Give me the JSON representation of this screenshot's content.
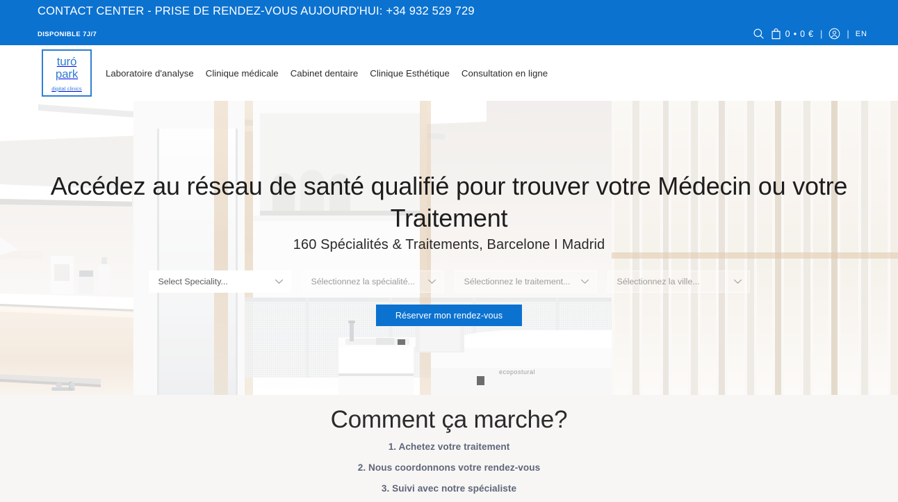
{
  "topbar": {
    "phone_text": "CONTACT CENTER - PRISE DE RENDEZ-VOUS AUJOURD'HUI: +34 932 529 729",
    "availability": "DISPONIBLE 7J/7",
    "search_icon": "search-icon",
    "cart_icon": "shopping-bag-icon",
    "cart_text": "0 • 0 €",
    "account_icon": "account-circle-icon",
    "separator": "|",
    "language": "EN",
    "bg_color": "#0b72d0"
  },
  "header": {
    "logo": {
      "line1": "turó",
      "line2": "park",
      "line3": "digital clinics",
      "color": "#2f7fd1"
    },
    "nav": [
      {
        "label": "Laboratoire d'analyse"
      },
      {
        "label": "Clinique médicale"
      },
      {
        "label": "Cabinet dentaire"
      },
      {
        "label": "Clinique Esthétique"
      },
      {
        "label": "Consultation en ligne"
      }
    ]
  },
  "hero": {
    "heading": "Accédez au réseau de santé qualifié pour trouver votre Médecin ou votre Traitement",
    "subheading": "160 Spécialités & Traitements, Barcelone I Madrid",
    "selects": [
      {
        "value": "Select Speciality...",
        "icon": "chevron-down-icon",
        "style": "primary"
      },
      {
        "value": "Sélectionnez la spécialité...",
        "icon": "chevron-down-icon",
        "style": "ghost"
      },
      {
        "value": "Sélectionnez le traitement...",
        "icon": "chevron-down-icon",
        "style": "ghost"
      },
      {
        "value": "Sélectionnez la ville...",
        "icon": "chevron-down-icon",
        "style": "ghost"
      }
    ],
    "cta_label": "Réserver mon rendez-vous",
    "cta_color": "#0b72d0"
  },
  "how_it_works": {
    "title": "Comment ça marche?",
    "steps": [
      {
        "label": "1. Achetez votre traitement"
      },
      {
        "label": "2. Nous coordonnons votre rendez-vous"
      },
      {
        "label": "3. Suivi avec notre spécialiste"
      }
    ],
    "text_color": "#5e6678",
    "bg_color": "#f7f6f5"
  }
}
